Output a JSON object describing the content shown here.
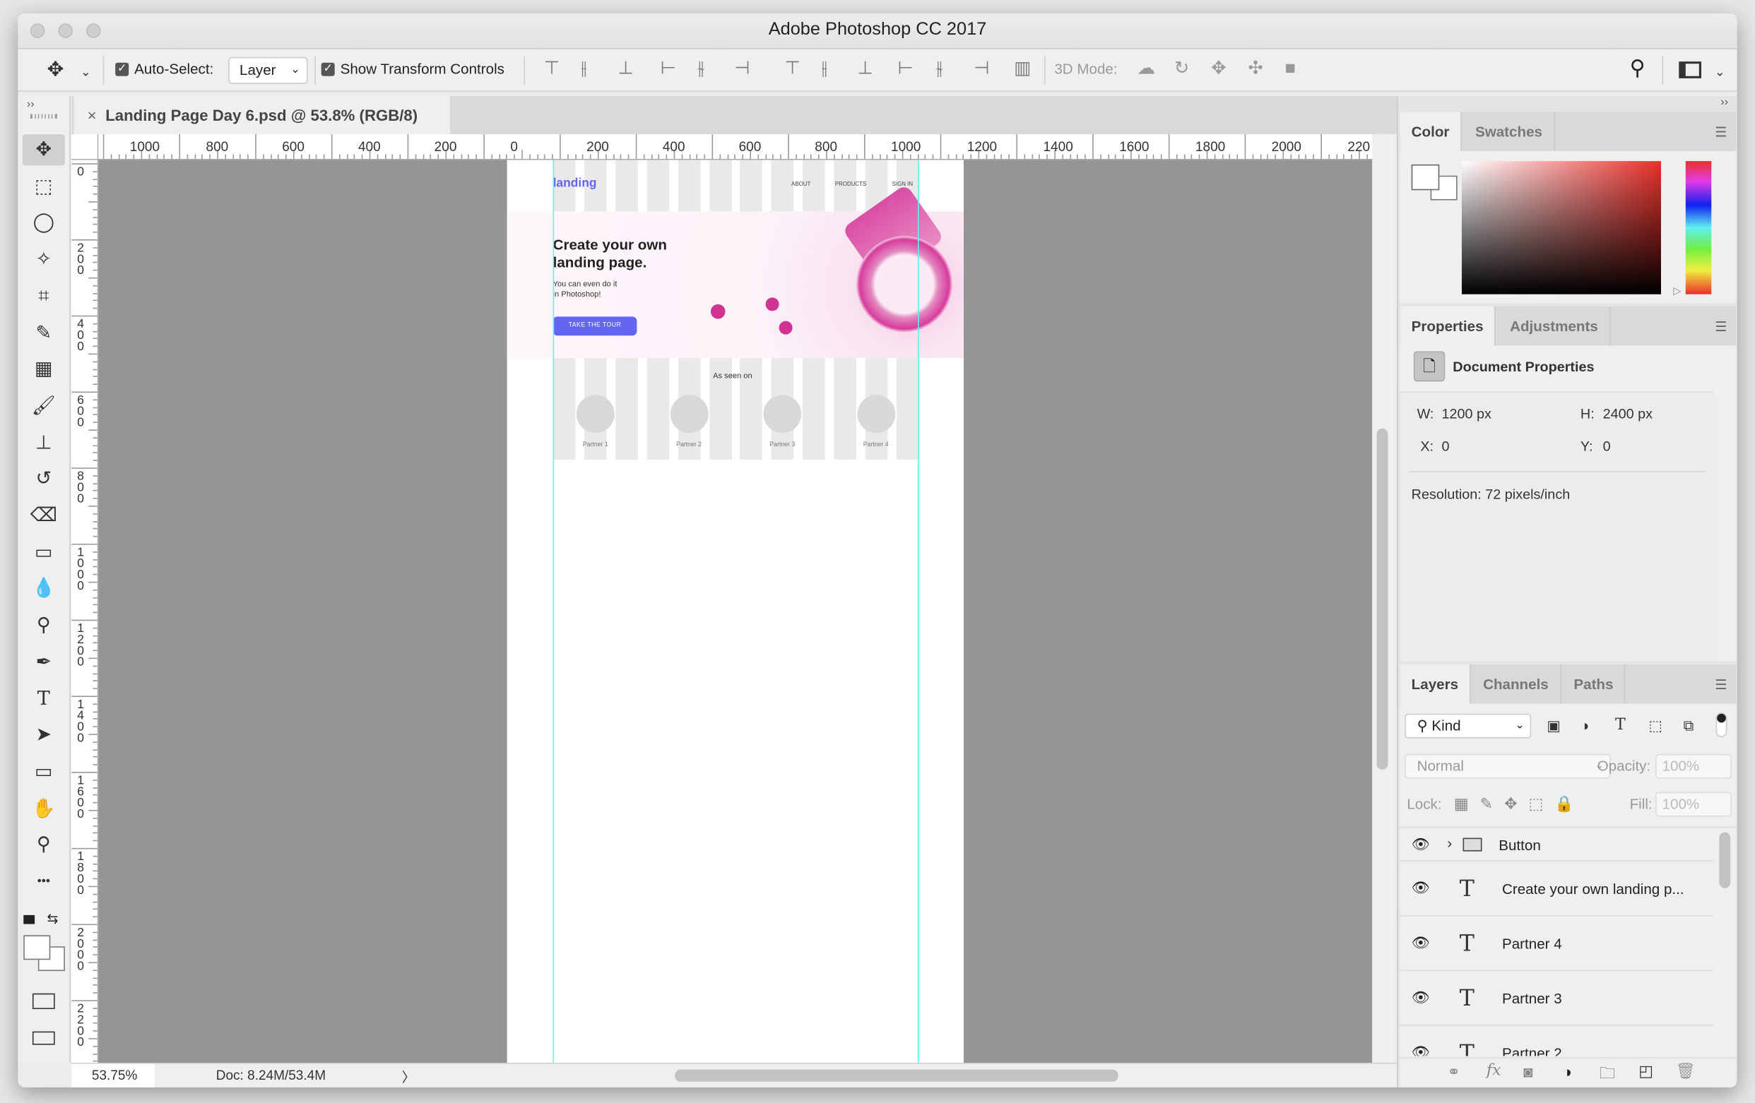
{
  "window": {
    "title": "Adobe Photoshop CC 2017"
  },
  "options_bar": {
    "tool_icon": "move-icon",
    "auto_select_label": "Auto-Select:",
    "auto_select_checked": true,
    "auto_select_value": "Layer",
    "show_transform_label": "Show Transform Controls",
    "show_transform_checked": true,
    "mode_3d_label": "3D Mode:",
    "align_icons": [
      "align-top-icon",
      "align-vcenter-icon",
      "align-bottom-icon",
      "align-left-icon",
      "align-hcenter-icon",
      "align-right-icon",
      "distribute-top-icon",
      "distribute-vcenter-icon",
      "distribute-bottom-icon",
      "distribute-left-icon",
      "distribute-hcenter-icon",
      "distribute-right-icon",
      "auto-align-icon"
    ],
    "mode_3d_icons": [
      "orbit-3d-icon",
      "roll-3d-icon",
      "pan-3d-icon",
      "slide-3d-icon",
      "scale-3d-icon"
    ]
  },
  "document_tab": {
    "close": "×",
    "title": "Landing Page Day 6.psd @ 53.8% (RGB/8)"
  },
  "rulers": {
    "horizontal": [
      "1000",
      "800",
      "600",
      "400",
      "200",
      "0",
      "200",
      "400",
      "600",
      "800",
      "1000",
      "1200",
      "1400",
      "1600",
      "1800",
      "2000",
      "220"
    ],
    "vertical": [
      "0",
      "200",
      "400",
      "600",
      "800",
      "1000",
      "1200",
      "1400",
      "1600",
      "1800",
      "2000",
      "2200"
    ]
  },
  "tools": [
    {
      "name": "move-tool",
      "glyph": "✥",
      "selected": true
    },
    {
      "name": "marquee-tool",
      "glyph": "⬚"
    },
    {
      "name": "lasso-tool",
      "glyph": "◯"
    },
    {
      "name": "magic-wand-tool",
      "glyph": "✧"
    },
    {
      "name": "crop-tool",
      "glyph": "⌗"
    },
    {
      "name": "eyedropper-tool",
      "glyph": "✎"
    },
    {
      "name": "frame-tool",
      "glyph": "▦"
    },
    {
      "name": "brush-tool",
      "glyph": "🖌"
    },
    {
      "name": "stamp-tool",
      "glyph": "⊥"
    },
    {
      "name": "history-brush-tool",
      "glyph": "↺"
    },
    {
      "name": "eraser-tool",
      "glyph": "⌫"
    },
    {
      "name": "gradient-tool",
      "glyph": "▭"
    },
    {
      "name": "blur-tool",
      "glyph": "💧"
    },
    {
      "name": "dodge-tool",
      "glyph": "⚲"
    },
    {
      "name": "pen-tool",
      "glyph": "✒"
    },
    {
      "name": "type-tool",
      "glyph": "T"
    },
    {
      "name": "path-selection-tool",
      "glyph": "➤"
    },
    {
      "name": "rectangle-tool",
      "glyph": "▭"
    },
    {
      "name": "hand-tool",
      "glyph": "✋"
    },
    {
      "name": "zoom-tool",
      "glyph": "⚲"
    },
    {
      "name": "more-tools",
      "glyph": "•••"
    }
  ],
  "canvas_doc": {
    "logo": "landing",
    "nav": [
      "ABOUT",
      "PRODUCTS",
      "SIGN IN"
    ],
    "headline_1": "Create your own",
    "headline_2": "landing page.",
    "sub_1": "You can even do it",
    "sub_2": "in Photoshop!",
    "cta": "TAKE THE TOUR",
    "as_seen_on": "As seen on",
    "partners": [
      "Partner 1",
      "Partner 2",
      "Partner 3",
      "Partner 4"
    ],
    "colors": {
      "accent": "#6366f1",
      "hero_pink": "#d63c9c",
      "stripe": "#e9e9e9",
      "guide": "#5ff0f5"
    }
  },
  "status_bar": {
    "zoom": "53.75%",
    "doc": "Doc: 8.24M/53.4M",
    "arrow": "〉"
  },
  "color_panel": {
    "tabs": [
      "Color",
      "Swatches"
    ],
    "active": "Color",
    "hue_color": "#e8302a"
  },
  "properties_panel": {
    "tabs": [
      "Properties",
      "Adjustments"
    ],
    "active": "Properties",
    "heading": "Document Properties",
    "w_label": "W:",
    "w": "1200 px",
    "h_label": "H:",
    "h": "2400 px",
    "x_label": "X:",
    "x": "0",
    "y_label": "Y:",
    "y": "0",
    "resolution": "Resolution: 72 pixels/inch"
  },
  "layers_panel": {
    "tabs": [
      "Layers",
      "Channels",
      "Paths"
    ],
    "active": "Layers",
    "filter": "Kind",
    "blend_mode": "Normal",
    "opacity_label": "Opacity:",
    "opacity": "100%",
    "lock_label": "Lock:",
    "fill_label": "Fill:",
    "fill": "100%",
    "layers": [
      {
        "type": "group",
        "name": "Button",
        "visible": true
      },
      {
        "type": "text",
        "name": "Create your own landing p...",
        "visible": true
      },
      {
        "type": "text",
        "name": "Partner 4",
        "visible": true
      },
      {
        "type": "text",
        "name": "Partner 3",
        "visible": true
      },
      {
        "type": "text",
        "name": "Partner 2",
        "visible": true
      }
    ],
    "footer_icons": [
      "link-icon",
      "fx-icon",
      "mask-icon",
      "adjustment-icon",
      "new-group-icon",
      "new-layer-icon",
      "trash-icon"
    ]
  }
}
